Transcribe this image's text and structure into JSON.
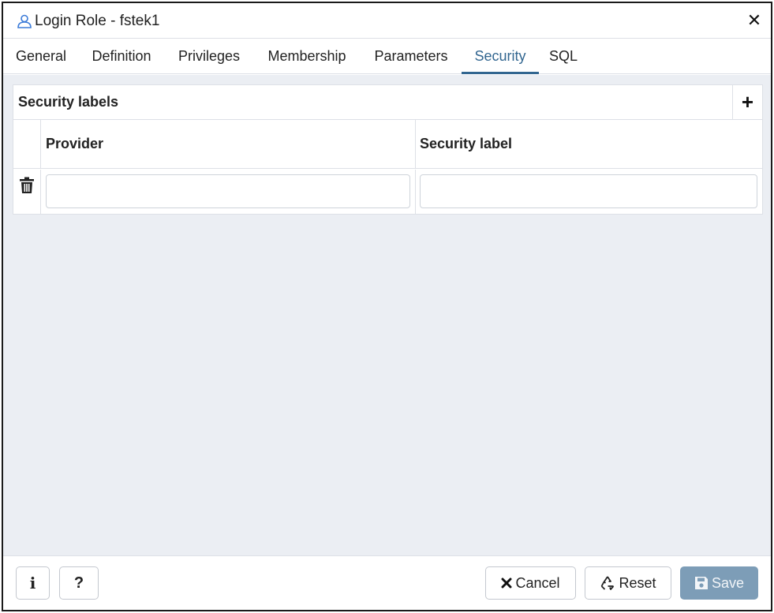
{
  "window": {
    "title": "Login Role - fstek1",
    "close_glyph": "✕",
    "title_icon": "user-icon"
  },
  "tabs": [
    {
      "label": "General",
      "active": false
    },
    {
      "label": "Definition",
      "active": false
    },
    {
      "label": "Privileges",
      "active": false
    },
    {
      "label": "Membership",
      "active": false
    },
    {
      "label": "Parameters",
      "active": false
    },
    {
      "label": "Security",
      "active": true
    },
    {
      "label": "SQL",
      "active": false
    }
  ],
  "security": {
    "section_title": "Security labels",
    "add_glyph": "+",
    "columns": [
      "Provider",
      "Security label"
    ],
    "rows": [
      {
        "provider": "",
        "security_label": ""
      }
    ]
  },
  "footer": {
    "info_glyph": "i",
    "help_glyph": "?",
    "cancel_label": "Cancel",
    "reset_label": "Reset",
    "save_label": "Save"
  },
  "colors": {
    "accent": "#326690",
    "content_bg": "#ebeef3",
    "save_disabled": "#7d9db7"
  }
}
